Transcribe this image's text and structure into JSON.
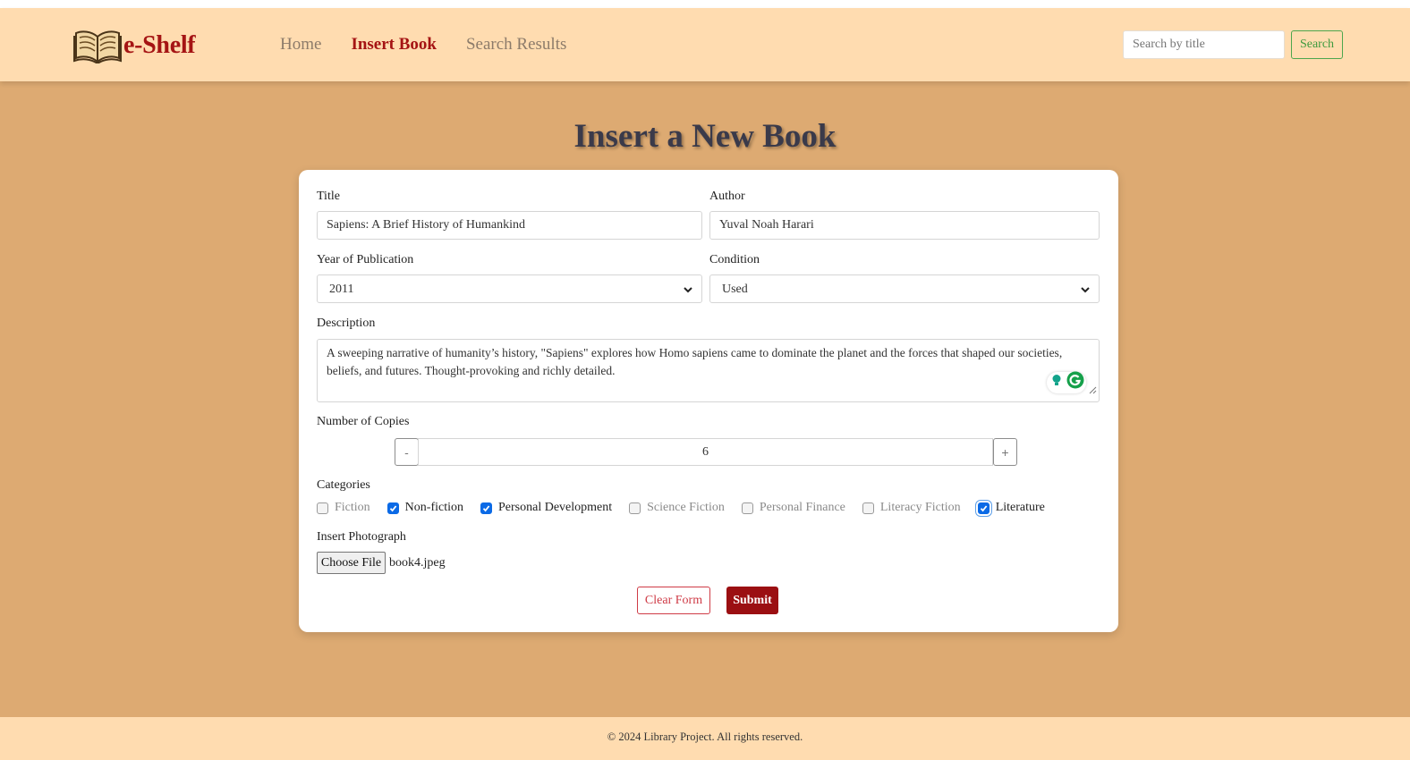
{
  "navbar": {
    "brand": "e-Shelf",
    "brand_icon": "open-book-icon",
    "links": [
      {
        "label": "Home",
        "active": false
      },
      {
        "label": "Insert Book",
        "active": true
      },
      {
        "label": "Search Results",
        "active": false
      }
    ],
    "search": {
      "placeholder": "Search by title",
      "button_label": "Search"
    }
  },
  "page": {
    "title": "Insert a New Book"
  },
  "form": {
    "title": {
      "label": "Title",
      "value": "Sapiens: A Brief History of Humankind"
    },
    "author": {
      "label": "Author",
      "value": "Yuval Noah Harari"
    },
    "year": {
      "label": "Year of Publication",
      "value": "2011"
    },
    "condition": {
      "label": "Condition",
      "value": "Used"
    },
    "description": {
      "label": "Description",
      "value": "A sweeping narrative of humanity’s history, \"Sapiens\" explores how Homo sapiens came to dominate the planet and the forces that shaped our societies, beliefs, and futures. Thought-provoking and richly detailed."
    },
    "copies": {
      "label": "Number of Copies",
      "value": "6",
      "decrement": "-",
      "increment": "+"
    },
    "categories": {
      "label": "Categories",
      "items": [
        {
          "label": "Fiction",
          "checked": false
        },
        {
          "label": "Non-fiction",
          "checked": true
        },
        {
          "label": "Personal Development",
          "checked": true
        },
        {
          "label": "Science Fiction",
          "checked": false
        },
        {
          "label": "Personal Finance",
          "checked": false
        },
        {
          "label": "Literacy Fiction",
          "checked": false
        },
        {
          "label": "Literature",
          "checked": true
        }
      ]
    },
    "photo": {
      "label": "Insert Photograph",
      "button_label": "Choose File",
      "file_name": "book4.jpeg"
    },
    "buttons": {
      "clear": "Clear Form",
      "submit": "Submit"
    }
  },
  "footer": {
    "text": "© 2024 Library Project. All rights reserved."
  },
  "colors": {
    "navbar_bg": "#ffdcb0",
    "page_bg": "#ddaa72",
    "brand": "#a51414",
    "submit": "#9b0f12",
    "checkbox": "#0b6ae6",
    "search_button": "#3e9a3e"
  }
}
